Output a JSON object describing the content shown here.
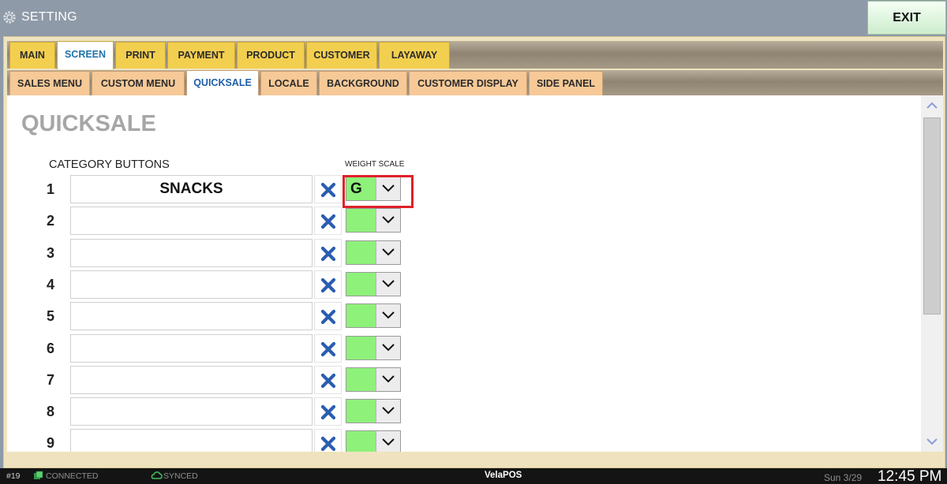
{
  "titlebar": {
    "title": "SETTING",
    "exit_label": "EXIT"
  },
  "tabs_main": [
    "MAIN",
    "SCREEN",
    "PRINT",
    "PAYMENT",
    "PRODUCT",
    "CUSTOMER",
    "LAYAWAY"
  ],
  "tabs_main_active": "SCREEN",
  "tabs_sub": [
    "SALES MENU",
    "CUSTOM MENU",
    "QUICKSALE",
    "LOCALE",
    "BACKGROUND",
    "CUSTOMER DISPLAY",
    "SIDE PANEL"
  ],
  "tabs_sub_active": "QUICKSALE",
  "page": {
    "title": "QUICKSALE",
    "category_label": "CATEGORY BUTTONS",
    "weight_scale_label": "WEIGHT SCALE",
    "rows": [
      {
        "num": "1",
        "category": "SNACKS",
        "weight_scale": "G"
      },
      {
        "num": "2",
        "category": "",
        "weight_scale": ""
      },
      {
        "num": "3",
        "category": "",
        "weight_scale": ""
      },
      {
        "num": "4",
        "category": "",
        "weight_scale": ""
      },
      {
        "num": "5",
        "category": "",
        "weight_scale": ""
      },
      {
        "num": "6",
        "category": "",
        "weight_scale": ""
      },
      {
        "num": "7",
        "category": "",
        "weight_scale": ""
      },
      {
        "num": "8",
        "category": "",
        "weight_scale": ""
      },
      {
        "num": "9",
        "category": "",
        "weight_scale": ""
      }
    ]
  },
  "statusbar": {
    "terminal": "#19",
    "connection": "CONNECTED",
    "sync": "SYNCED",
    "brand": "VelaPOS",
    "date": "Sun 3/29",
    "time": "12:45 PM"
  },
  "colors": {
    "titlebar_bg": "#8e9aa8",
    "main_tab": "#f3cf4f",
    "sub_tab": "#f6c997",
    "weight_scale_bg": "#8ef17a",
    "clear_icon": "#2a5db0",
    "highlight": "#e0202a"
  },
  "icons": {
    "title": "gear-icon",
    "clear": "close-x-icon",
    "dropdown": "chevron-down-icon",
    "connection": "network-icon",
    "sync": "cloud-icon"
  }
}
